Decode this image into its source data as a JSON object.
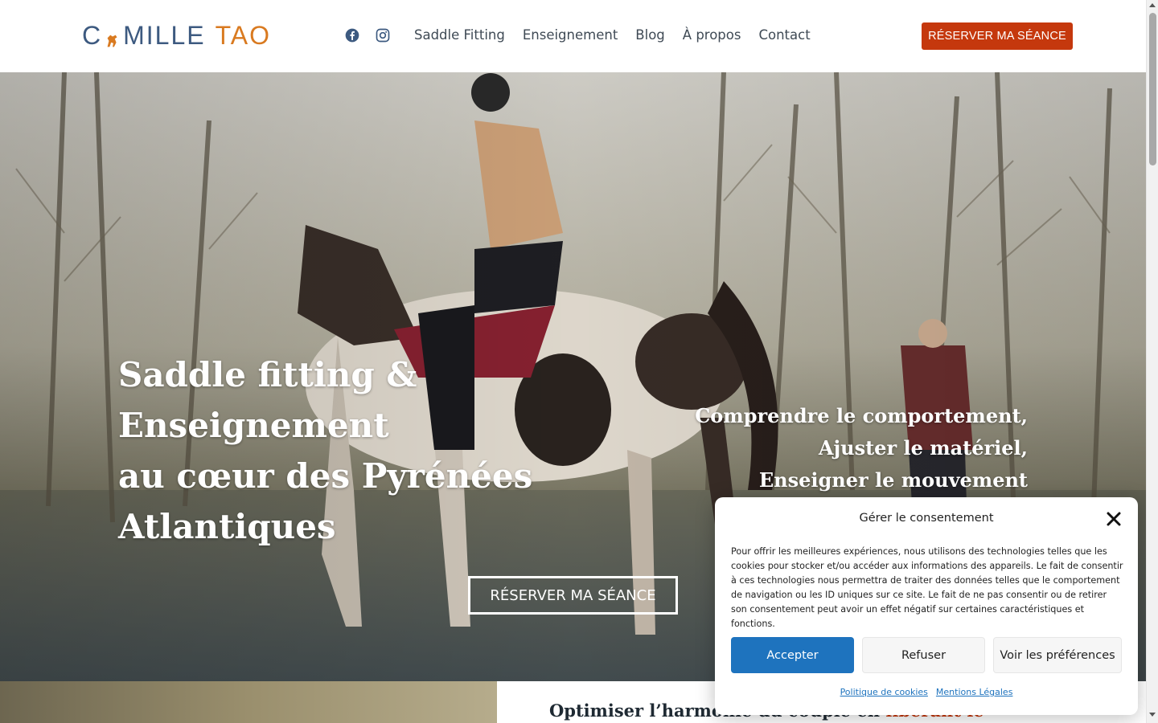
{
  "header": {
    "logo": {
      "part1": "C",
      "part2": "MILLE",
      "part3": "TAO",
      "icon": "horse-icon"
    },
    "social": [
      {
        "name": "facebook-icon",
        "color": "#1877f2"
      },
      {
        "name": "instagram-icon",
        "color": "#3d5a80"
      }
    ],
    "nav": [
      "Saddle Fitting",
      "Enseignement",
      "Blog",
      "À propos",
      "Contact"
    ],
    "cta_label": "RÉSERVER MA SÉANCE"
  },
  "hero": {
    "title_lines": [
      "Saddle fitting &",
      "Enseignement",
      "au cœur des Pyrénées",
      "Atlantiques"
    ],
    "subtitle_lines": [
      "Comprendre le comportement,",
      "Ajuster le matériel,",
      "Enseigner le mouvement"
    ],
    "cta_label": "RÉSERVER MA SÉANCE"
  },
  "section": {
    "heading_part1": "Optimiser l’harmonie du couple en ",
    "heading_accent": "libérant le"
  },
  "consent": {
    "title": "Gérer le consentement",
    "body": "Pour offrir les meilleures expériences, nous utilisons des technologies telles que les cookies pour stocker et/ou accéder aux informations des appareils. Le fait de consentir à ces technologies nous permettra de traiter des données telles que le comportement de navigation ou les ID uniques sur ce site. Le fait de ne pas consentir ou de retirer son consentement peut avoir un effet négatif sur certaines caractéristiques et fonctions.",
    "accept": "Accepter",
    "deny": "Refuser",
    "prefs": "Voir les préférences",
    "links": [
      "Politique de cookies",
      "Mentions Légales"
    ]
  },
  "colors": {
    "accent": "#c5380d",
    "brand_blue": "#3d5a80",
    "brand_orange": "#d97a20",
    "consent_blue": "#1e73be"
  }
}
